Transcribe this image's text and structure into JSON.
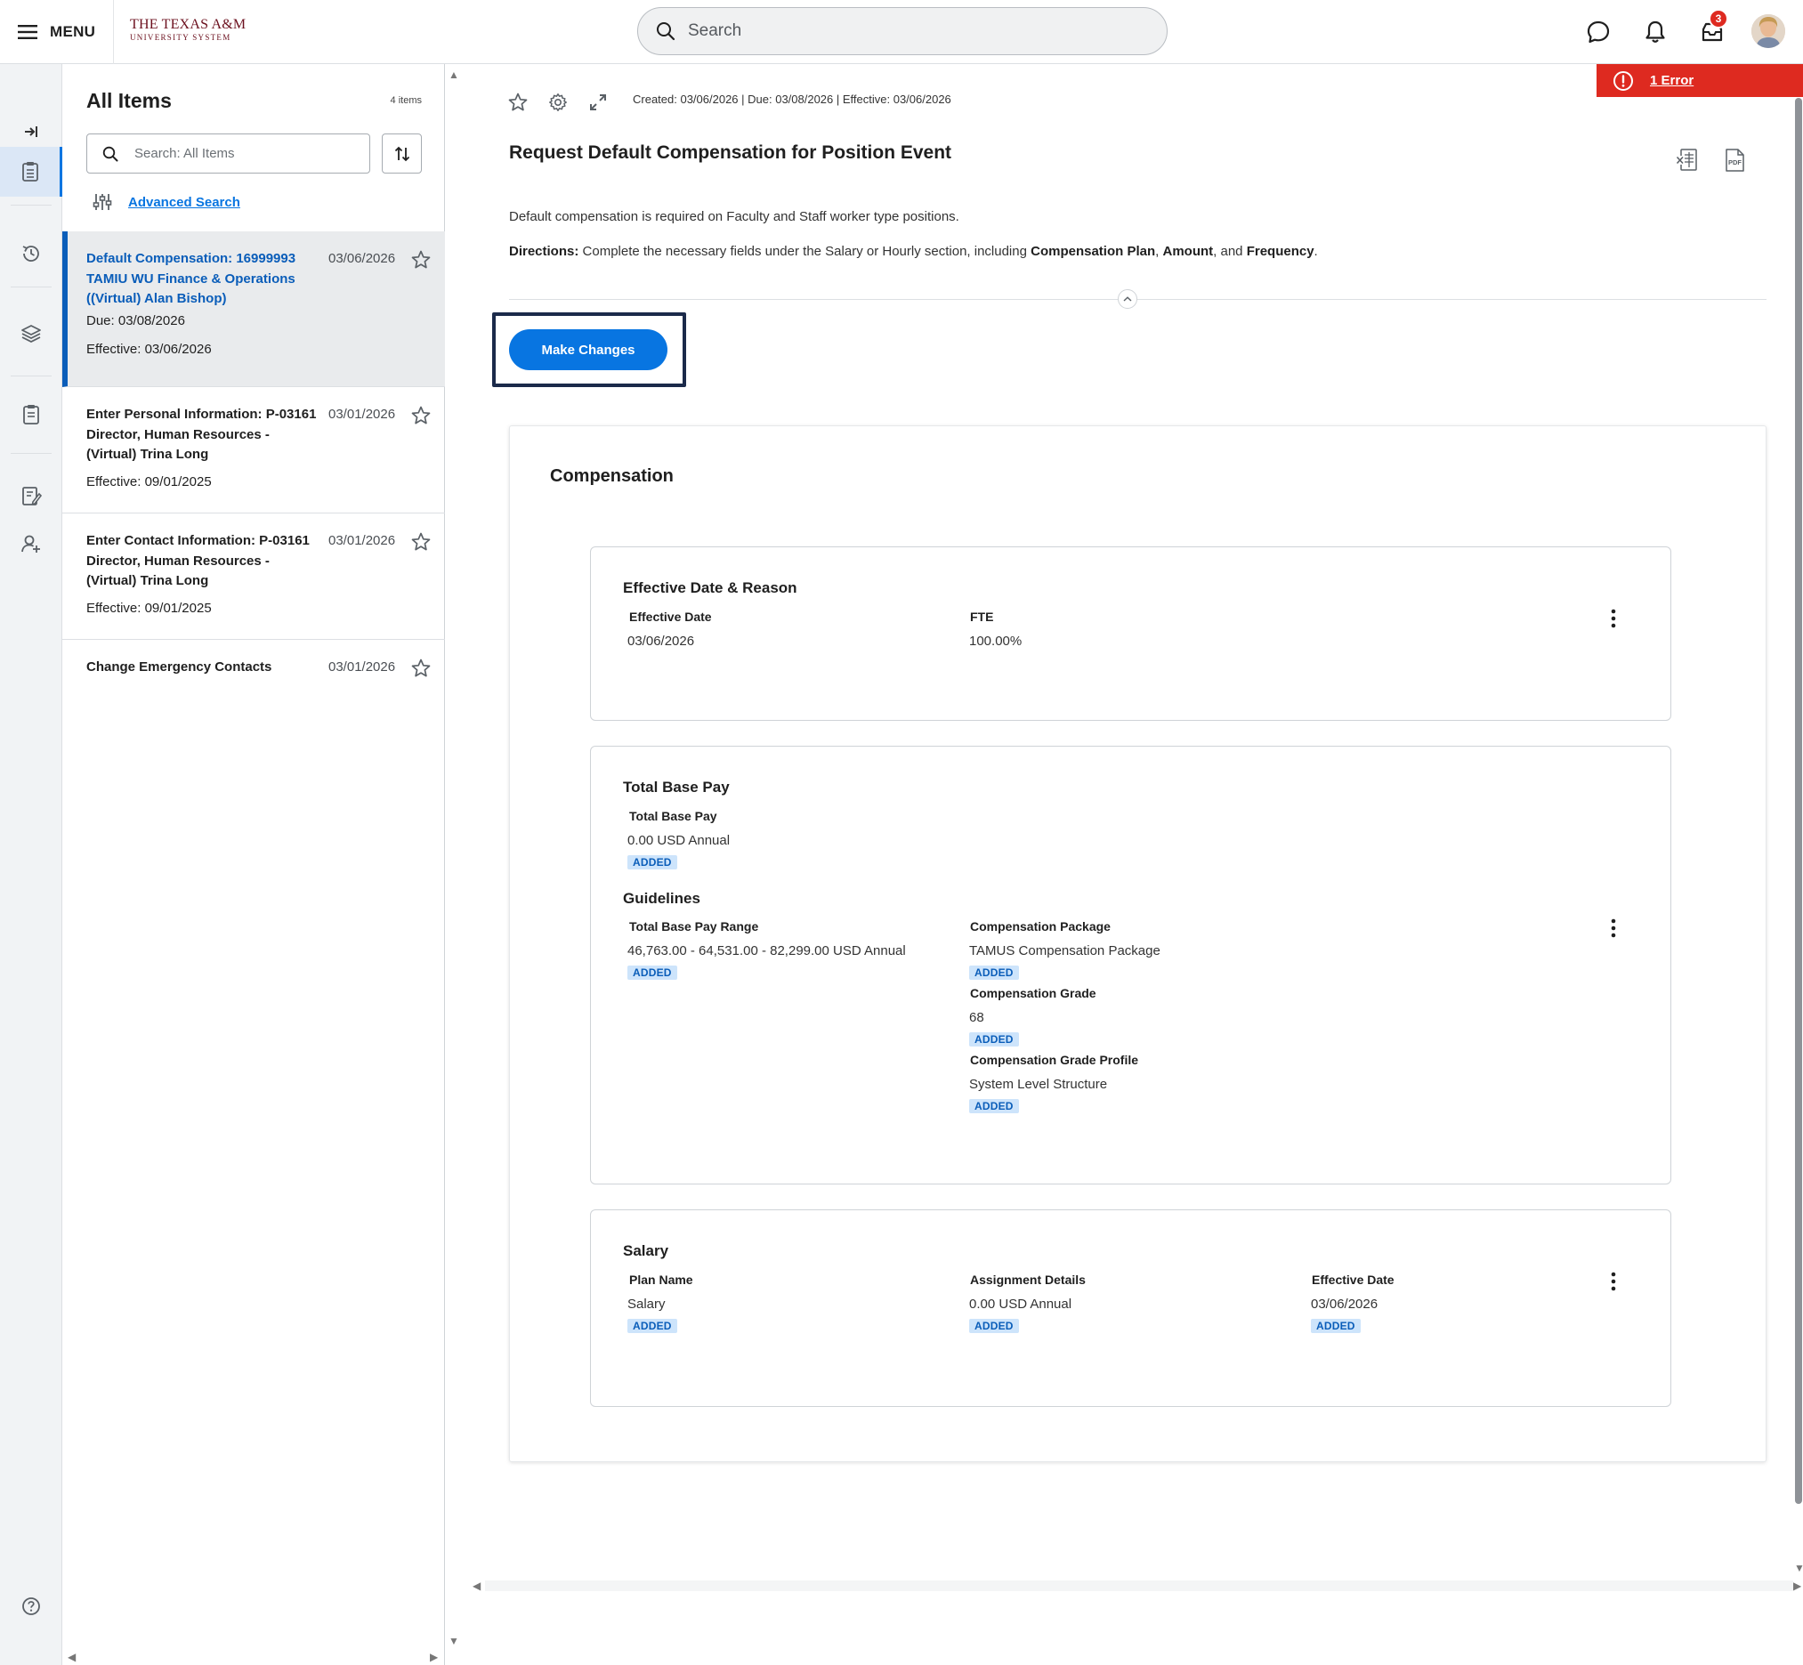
{
  "header": {
    "menu_label": "MENU",
    "logo_line1": "THE TEXAS A&M",
    "logo_line2": "UNIVERSITY SYSTEM",
    "search_placeholder": "Search",
    "inbox_badge_count": "3",
    "icons": [
      "menu-icon",
      "search-icon",
      "chat-icon",
      "bell-icon",
      "inbox-icon",
      "avatar"
    ]
  },
  "left_rail": {
    "items": [
      "expand-icon",
      "tasks-icon",
      "history-icon",
      "layers-icon",
      "clipboard-icon",
      "form-icon",
      "add-user-icon",
      "help-icon"
    ]
  },
  "items_panel": {
    "title": "All Items",
    "count": "4 items",
    "search_placeholder": "Search: All Items",
    "advanced_search_label": "Advanced Search",
    "items": [
      {
        "title": "Default Compensation: 16999993 TAMIU WU Finance & Operations ((Virtual) Alan Bishop)",
        "date": "03/06/2026",
        "due": "Due: 03/08/2026",
        "effective": "Effective: 03/06/2026",
        "selected": true
      },
      {
        "title": "Enter Personal Information: P-03161 Director, Human Resources - (Virtual) Trina Long",
        "date": "03/01/2026",
        "effective": "Effective: 09/01/2025"
      },
      {
        "title": "Enter Contact Information: P-03161 Director, Human Resources - (Virtual) Trina Long",
        "date": "03/01/2026",
        "effective": "Effective: 09/01/2025"
      },
      {
        "title": "Change Emergency Contacts",
        "date": "03/01/2026"
      }
    ]
  },
  "main": {
    "meta_line": "Created: 03/06/2026 | Due: 03/08/2026 | Effective: 03/06/2026",
    "title": "Request Default Compensation for Position Event",
    "intro": "Default compensation is required on Faculty and Staff worker type positions.",
    "directions_label": "Directions:",
    "directions_text_1": " Complete the necessary fields under the Salary or Hourly section, including ",
    "directions_bold_1": "Compensation Plan",
    "directions_sep_1": ", ",
    "directions_bold_2": "Amount",
    "directions_sep_2": ", and ",
    "directions_bold_3": "Frequency",
    "directions_end": ".",
    "make_changes_label": "Make Changes",
    "error_label": "1 Error",
    "compensation": {
      "title": "Compensation",
      "effective": {
        "title": "Effective Date & Reason",
        "effective_date_label": "Effective Date",
        "effective_date_value": "03/06/2026",
        "fte_label": "FTE",
        "fte_value": "100.00%"
      },
      "base_pay": {
        "title": "Total Base Pay",
        "total_label": "Total Base Pay",
        "total_value": "0.00 USD Annual",
        "badge": "ADDED",
        "guidelines_title": "Guidelines",
        "range_label": "Total Base Pay Range",
        "range_value": "46,763.00 - 64,531.00 - 82,299.00 USD Annual",
        "package_label": "Compensation Package",
        "package_value": "TAMUS Compensation Package",
        "grade_label": "Compensation Grade",
        "grade_value": "68",
        "profile_label": "Compensation Grade Profile",
        "profile_value": "System Level Structure"
      },
      "salary": {
        "title": "Salary",
        "plan_label": "Plan Name",
        "plan_value": "Salary",
        "assign_label": "Assignment Details",
        "assign_value": "0.00 USD Annual",
        "eff_label": "Effective Date",
        "eff_value": "03/06/2026",
        "badge": "ADDED"
      }
    }
  },
  "colors": {
    "primary": "#0875e1",
    "error": "#de2a20",
    "selected_link": "#0a5db9",
    "logo": "#6b0f1d",
    "badge_bg": "#cde4fb"
  }
}
